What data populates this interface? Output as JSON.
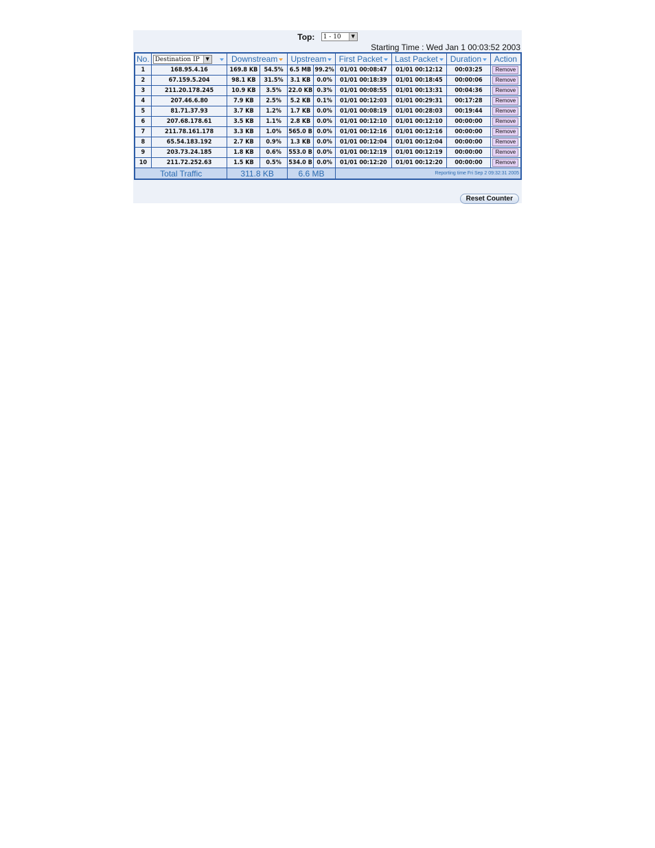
{
  "top": {
    "label": "Top:",
    "selected": "1 - 10"
  },
  "starting_time": "Starting Time : Wed Jan 1 00:03:52 2003",
  "columns": {
    "no": "No.",
    "filter_selected": "Destination IP",
    "downstream": "Downstream",
    "upstream": "Upstream",
    "first_packet": "First Packet",
    "last_packet": "Last Packet",
    "duration": "Duration",
    "action": "Action"
  },
  "rows": [
    {
      "no": "1",
      "ip": "168.95.4.16",
      "down": "169.8 KB",
      "down_pct": "54.5%",
      "up": "6.5 MB",
      "up_pct": "99.2%",
      "first": "01/01 00:08:47",
      "last": "01/01 00:12:12",
      "dur": "00:03:25",
      "action": "Remove"
    },
    {
      "no": "2",
      "ip": "67.159.5.204",
      "down": "98.1 KB",
      "down_pct": "31.5%",
      "up": "3.1 KB",
      "up_pct": "0.0%",
      "first": "01/01 00:18:39",
      "last": "01/01 00:18:45",
      "dur": "00:00:06",
      "action": "Remove"
    },
    {
      "no": "3",
      "ip": "211.20.178.245",
      "down": "10.9 KB",
      "down_pct": "3.5%",
      "up": "22.0 KB",
      "up_pct": "0.3%",
      "first": "01/01 00:08:55",
      "last": "01/01 00:13:31",
      "dur": "00:04:36",
      "action": "Remove"
    },
    {
      "no": "4",
      "ip": "207.46.6.80",
      "down": "7.9 KB",
      "down_pct": "2.5%",
      "up": "5.2 KB",
      "up_pct": "0.1%",
      "first": "01/01 00:12:03",
      "last": "01/01 00:29:31",
      "dur": "00:17:28",
      "action": "Remove"
    },
    {
      "no": "5",
      "ip": "81.71.37.93",
      "down": "3.7 KB",
      "down_pct": "1.2%",
      "up": "1.7 KB",
      "up_pct": "0.0%",
      "first": "01/01 00:08:19",
      "last": "01/01 00:28:03",
      "dur": "00:19:44",
      "action": "Remove"
    },
    {
      "no": "6",
      "ip": "207.68.178.61",
      "down": "3.5 KB",
      "down_pct": "1.1%",
      "up": "2.8 KB",
      "up_pct": "0.0%",
      "first": "01/01 00:12:10",
      "last": "01/01 00:12:10",
      "dur": "00:00:00",
      "action": "Remove"
    },
    {
      "no": "7",
      "ip": "211.78.161.178",
      "down": "3.3 KB",
      "down_pct": "1.0%",
      "up": "565.0 B",
      "up_pct": "0.0%",
      "first": "01/01 00:12:16",
      "last": "01/01 00:12:16",
      "dur": "00:00:00",
      "action": "Remove"
    },
    {
      "no": "8",
      "ip": "65.54.183.192",
      "down": "2.7 KB",
      "down_pct": "0.9%",
      "up": "1.3 KB",
      "up_pct": "0.0%",
      "first": "01/01 00:12:04",
      "last": "01/01 00:12:04",
      "dur": "00:00:00",
      "action": "Remove"
    },
    {
      "no": "9",
      "ip": "203.73.24.185",
      "down": "1.8 KB",
      "down_pct": "0.6%",
      "up": "553.0 B",
      "up_pct": "0.0%",
      "first": "01/01 00:12:19",
      "last": "01/01 00:12:19",
      "dur": "00:00:00",
      "action": "Remove"
    },
    {
      "no": "10",
      "ip": "211.72.252.63",
      "down": "1.5 KB",
      "down_pct": "0.5%",
      "up": "534.0 B",
      "up_pct": "0.0%",
      "first": "01/01 00:12:20",
      "last": "01/01 00:12:20",
      "dur": "00:00:00",
      "action": "Remove"
    }
  ],
  "total": {
    "label": "Total Traffic",
    "downstream": "311.8 KB",
    "upstream": "6.6 MB",
    "reporting_time": "Reporting time Fri Sep 2 09:32:31 2005"
  },
  "reset_label": "Reset Counter",
  "colors": {
    "border": "#2b5ba6",
    "header_text": "#2a6ab0",
    "sort_active": "#f2a23c",
    "sort_inactive": "#5fa0e6",
    "remove_bg": "#e6d3f5"
  }
}
